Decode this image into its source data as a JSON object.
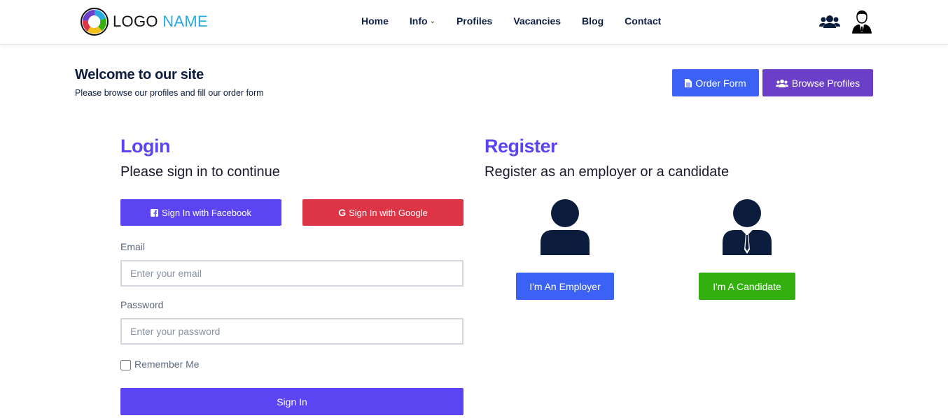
{
  "header": {
    "logo": {
      "part1": "LOGO",
      "part2": "NAME"
    },
    "nav": [
      {
        "label": "Home"
      },
      {
        "label": "Info",
        "has_dropdown": true
      },
      {
        "label": "Profiles"
      },
      {
        "label": "Vacancies"
      },
      {
        "label": "Blog"
      },
      {
        "label": "Contact"
      }
    ],
    "icons": [
      "users-icon",
      "user-avatar-icon"
    ]
  },
  "welcome": {
    "title": "Welcome to our site",
    "subtitle": "Please browse our profiles and fill our order form",
    "order_button": "Order Form",
    "browse_button": "Browse Profiles"
  },
  "login": {
    "title": "Login",
    "subtitle": "Please sign in to continue",
    "facebook_button": "Sign In with Facebook",
    "google_button": "Sign In with Google",
    "email_label": "Email",
    "email_placeholder": "Enter your email",
    "password_label": "Password",
    "password_placeholder": "Enter your password",
    "remember_label": "Remember Me",
    "remember_checked": false,
    "signin_button": "Sign In"
  },
  "register": {
    "title": "Register",
    "subtitle": "Register as an employer or a candidate",
    "employer_button": "I'm An Employer",
    "candidate_button": "I'm A Candidate"
  },
  "colors": {
    "primary_purple": "#5b45f2",
    "blue": "#3c62f5",
    "violet": "#6c3fc8",
    "red": "#de3546",
    "green": "#33b00f",
    "navy": "#0b1c3c"
  }
}
